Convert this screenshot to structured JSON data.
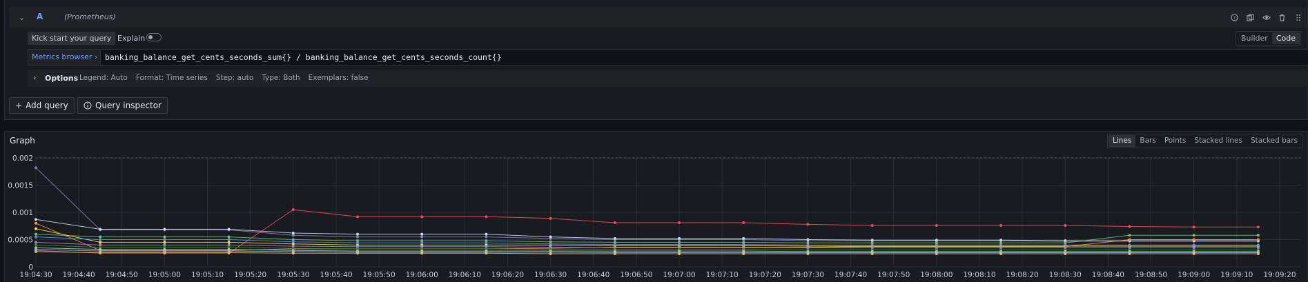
{
  "query": {
    "letter": "A",
    "datasource": "(Prometheus)",
    "kick_start_label": "Kick start your query",
    "explain_label": "Explain",
    "modes": [
      "Builder",
      "Code"
    ],
    "active_mode": "Code",
    "metrics_browser_label": "Metrics browser ›",
    "expression": "banking_balance_get_cents_seconds_sum{} / banking_balance_get_cents_seconds_count{}",
    "options_title": "Options",
    "options": [
      "Legend: Auto",
      "Format: Time series",
      "Step: auto",
      "Type: Both",
      "Exemplars: false"
    ],
    "add_query_label": "Add query",
    "query_inspector_label": "Query inspector"
  },
  "graph": {
    "title": "Graph",
    "viz_types": [
      "Lines",
      "Bars",
      "Points",
      "Stacked lines",
      "Stacked bars"
    ],
    "active_viz": "Lines"
  },
  "chart_data": {
    "type": "line",
    "title": "",
    "xlabel": "",
    "ylabel": "",
    "ylim": [
      0,
      0.002
    ],
    "yticks": [
      "0",
      "0.0005",
      "0.001",
      "0.0015",
      "0.002"
    ],
    "xlim": [
      "19:04:30",
      "19:09:25"
    ],
    "grid": true,
    "categories": [
      "19:04:30",
      "19:04:45",
      "19:05:00",
      "19:05:15",
      "19:05:30",
      "19:05:45",
      "19:06:00",
      "19:06:15",
      "19:06:30",
      "19:06:45",
      "19:07:00",
      "19:07:15",
      "19:07:30",
      "19:07:45",
      "19:08:00",
      "19:08:15",
      "19:08:30",
      "19:08:45",
      "19:09:00",
      "19:09:15"
    ],
    "xticks": [
      "19:04:30",
      "19:04:40",
      "19:04:50",
      "19:05:00",
      "19:05:10",
      "19:05:20",
      "19:05:30",
      "19:05:40",
      "19:05:50",
      "19:06:00",
      "19:06:10",
      "19:06:20",
      "19:06:30",
      "19:06:40",
      "19:06:50",
      "19:07:00",
      "19:07:10",
      "19:07:20",
      "19:07:30",
      "19:07:40",
      "19:07:50",
      "19:08:00",
      "19:08:10",
      "19:08:20",
      "19:08:30",
      "19:08:40",
      "19:08:50",
      "19:09:00",
      "19:09:10",
      "19:09:20"
    ],
    "series": [
      {
        "color": "#8e7cc3",
        "values": [
          0.00182,
          0.00068,
          0.00068,
          0.00068,
          0.00058,
          0.00055,
          0.00055,
          0.00055,
          0.00052,
          0.0005,
          0.0005,
          0.0005,
          0.00048,
          0.00048,
          0.00048,
          0.00048,
          0.00047,
          0.00047,
          0.00047,
          0.00047
        ]
      },
      {
        "color": "#f2495c",
        "values": [
          0.0003,
          0.00025,
          0.00025,
          0.00025,
          0.00105,
          0.00092,
          0.00092,
          0.00092,
          0.00089,
          0.00081,
          0.00081,
          0.00081,
          0.00078,
          0.00076,
          0.00076,
          0.00076,
          0.00076,
          0.00074,
          0.00073,
          0.00073
        ]
      },
      {
        "color": "#c8d6f0",
        "values": [
          0.00087,
          0.00069,
          0.00069,
          0.00069,
          0.00062,
          0.0006,
          0.0006,
          0.0006,
          0.00055,
          0.00052,
          0.00052,
          0.00052,
          0.0005,
          0.00049,
          0.00049,
          0.00049,
          0.00048,
          0.00048,
          0.00048,
          0.00048
        ]
      },
      {
        "color": "#73bf69",
        "values": [
          0.0006,
          0.00055,
          0.00055,
          0.00055,
          0.0005,
          0.00048,
          0.00048,
          0.00048,
          0.00046,
          0.00045,
          0.00045,
          0.00045,
          0.00044,
          0.00044,
          0.00044,
          0.00044,
          0.00044,
          0.00058,
          0.00058,
          0.00058
        ]
      },
      {
        "color": "#fade2a",
        "values": [
          0.0007,
          0.00045,
          0.00045,
          0.00045,
          0.00042,
          0.0004,
          0.0004,
          0.0004,
          0.0004,
          0.00039,
          0.00039,
          0.00039,
          0.00038,
          0.00038,
          0.00038,
          0.00038,
          0.00038,
          0.00038,
          0.00038,
          0.00038
        ]
      },
      {
        "color": "#5794f2",
        "values": [
          0.00055,
          0.0005,
          0.0005,
          0.0005,
          0.00046,
          0.00044,
          0.00044,
          0.00044,
          0.00042,
          0.00041,
          0.00041,
          0.00041,
          0.0004,
          0.0004,
          0.0004,
          0.0004,
          0.0004,
          0.0004,
          0.0004,
          0.0004
        ]
      },
      {
        "color": "#ff9830",
        "values": [
          0.0008,
          0.0003,
          0.0003,
          0.0003,
          0.00033,
          0.00033,
          0.00033,
          0.00033,
          0.00034,
          0.00036,
          0.00036,
          0.00036,
          0.00036,
          0.00037,
          0.00037,
          0.00037,
          0.00037,
          0.0005,
          0.0005,
          0.0005
        ]
      },
      {
        "color": "#b877d9",
        "values": [
          0.00045,
          0.0004,
          0.0004,
          0.0004,
          0.00038,
          0.00037,
          0.00037,
          0.00037,
          0.00036,
          0.00035,
          0.00035,
          0.00035,
          0.00035,
          0.00035,
          0.00035,
          0.00035,
          0.00035,
          0.00035,
          0.00035,
          0.00035
        ]
      },
      {
        "color": "#37872d",
        "values": [
          0.0004,
          0.00036,
          0.00036,
          0.00036,
          0.00034,
          0.00033,
          0.00033,
          0.00033,
          0.00032,
          0.00032,
          0.00032,
          0.00032,
          0.00031,
          0.00031,
          0.00031,
          0.00031,
          0.00031,
          0.00031,
          0.00031,
          0.00031
        ]
      },
      {
        "color": "#96d98d",
        "values": [
          0.00035,
          0.00032,
          0.00032,
          0.00032,
          0.0003,
          0.00029,
          0.00029,
          0.00029,
          0.00029,
          0.00029,
          0.00029,
          0.00029,
          0.00028,
          0.00028,
          0.00028,
          0.00028,
          0.00028,
          0.00028,
          0.00028,
          0.00028
        ]
      },
      {
        "color": "#8ab8ff",
        "values": [
          0.00032,
          0.00029,
          0.00029,
          0.00029,
          0.00028,
          0.00027,
          0.00027,
          0.00027,
          0.00027,
          0.00026,
          0.00026,
          0.00026,
          0.00026,
          0.00026,
          0.00026,
          0.00026,
          0.00026,
          0.00026,
          0.00026,
          0.00026
        ]
      },
      {
        "color": "#ffb357",
        "values": [
          0.00028,
          0.00026,
          0.00026,
          0.00026,
          0.00025,
          0.00025,
          0.00025,
          0.00025,
          0.00024,
          0.00024,
          0.00024,
          0.00024,
          0.00024,
          0.00024,
          0.00024,
          0.00024,
          0.00024,
          0.00024,
          0.00024,
          0.00024
        ]
      }
    ]
  }
}
